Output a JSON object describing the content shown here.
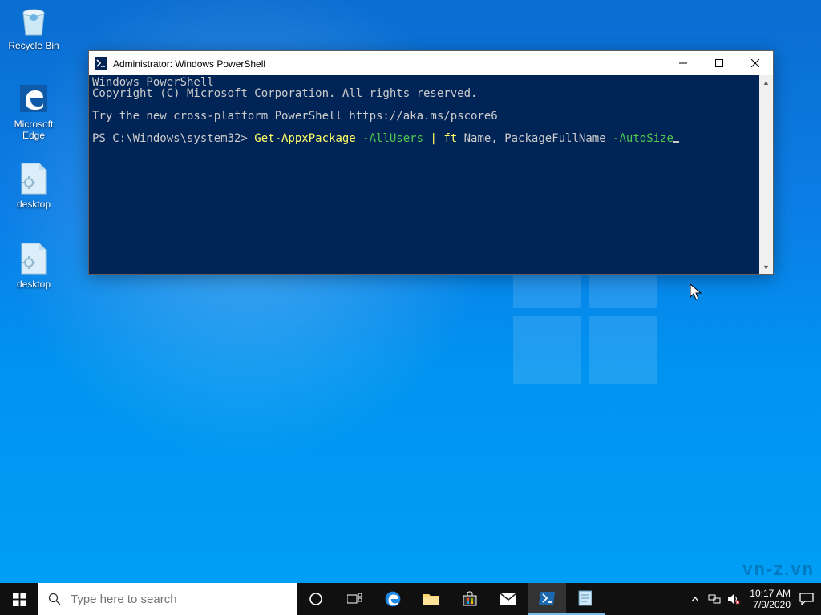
{
  "desktop_icons": {
    "recycle_bin": "Recycle Bin",
    "edge": "Microsoft Edge",
    "dfile1": "desktop",
    "dfile2": "desktop"
  },
  "powershell": {
    "title": "Administrator: Windows PowerShell",
    "line1": "Windows PowerShell",
    "line2": "Copyright (C) Microsoft Corporation. All rights reserved.",
    "line3": "Try the new cross-platform PowerShell https://aka.ms/pscore6",
    "prompt": "PS C:\\Windows\\system32> ",
    "cmd1": "Get-AppxPackage",
    "cmd2": " -AllUsers ",
    "cmd3": "|",
    "cmd4": " ft ",
    "cmd5": "Name",
    "cmd6": ", ",
    "cmd7": "PackageFullName",
    "cmd8": " -AutoSize"
  },
  "taskbar": {
    "search_placeholder": "Type here to search",
    "time": "10:17 AM",
    "date": "7/9/2020"
  },
  "watermark": "vn-z.vn"
}
